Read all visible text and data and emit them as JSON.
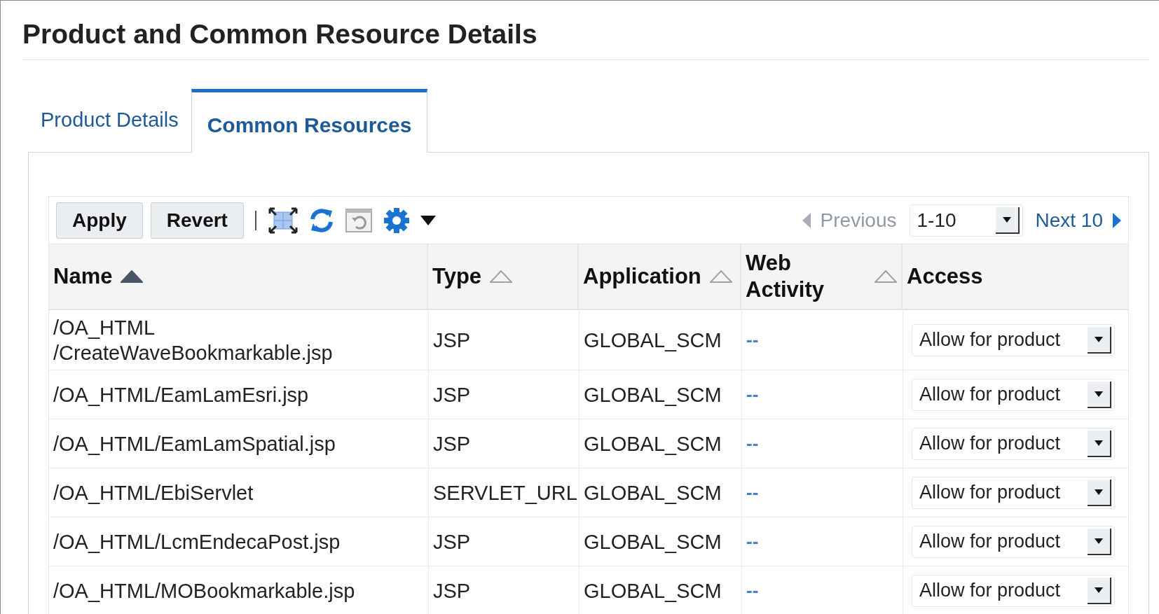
{
  "page_title": "Product and Common Resource Details",
  "tabs": [
    {
      "label": "Product Details",
      "selected": false
    },
    {
      "label": "Common Resources",
      "selected": true
    }
  ],
  "toolbar": {
    "buttons": [
      "Apply",
      "Revert"
    ]
  },
  "pagination": {
    "previous": {
      "label": "Previous",
      "disabled": true
    },
    "range": "1-10",
    "next": {
      "label": "Next 10",
      "disabled": false
    }
  },
  "table": {
    "columns": [
      {
        "label": "Name",
        "sortable": true,
        "sorted": true
      },
      {
        "label": "Type",
        "sortable": true,
        "sorted": false
      },
      {
        "label": "Application",
        "sortable": true,
        "sorted": false
      },
      {
        "label": "Web Activity",
        "sortable": true,
        "sorted": false
      },
      {
        "label": "Access",
        "sortable": false
      }
    ],
    "rows": [
      {
        "name": "/OA_HTML\n/CreateWaveBookmarkable.jsp",
        "type": "JSP",
        "application": "GLOBAL_SCM",
        "web_activity": "--",
        "access": "Allow for product"
      },
      {
        "name": "/OA_HTML/EamLamEsri.jsp",
        "type": "JSP",
        "application": "GLOBAL_SCM",
        "web_activity": "--",
        "access": "Allow for product"
      },
      {
        "name": "/OA_HTML/EamLamSpatial.jsp",
        "type": "JSP",
        "application": "GLOBAL_SCM",
        "web_activity": "--",
        "access": "Allow for product"
      },
      {
        "name": "/OA_HTML/EbiServlet",
        "type": "SERVLET_URL",
        "application": "GLOBAL_SCM",
        "web_activity": "--",
        "access": "Allow for product"
      },
      {
        "name": "/OA_HTML/LcmEndecaPost.jsp",
        "type": "JSP",
        "application": "GLOBAL_SCM",
        "web_activity": "--",
        "access": "Allow for product"
      },
      {
        "name": "/OA_HTML/MOBookmarkable.jsp",
        "type": "JSP",
        "application": "GLOBAL_SCM",
        "web_activity": "--",
        "access": "Allow for product"
      }
    ]
  }
}
